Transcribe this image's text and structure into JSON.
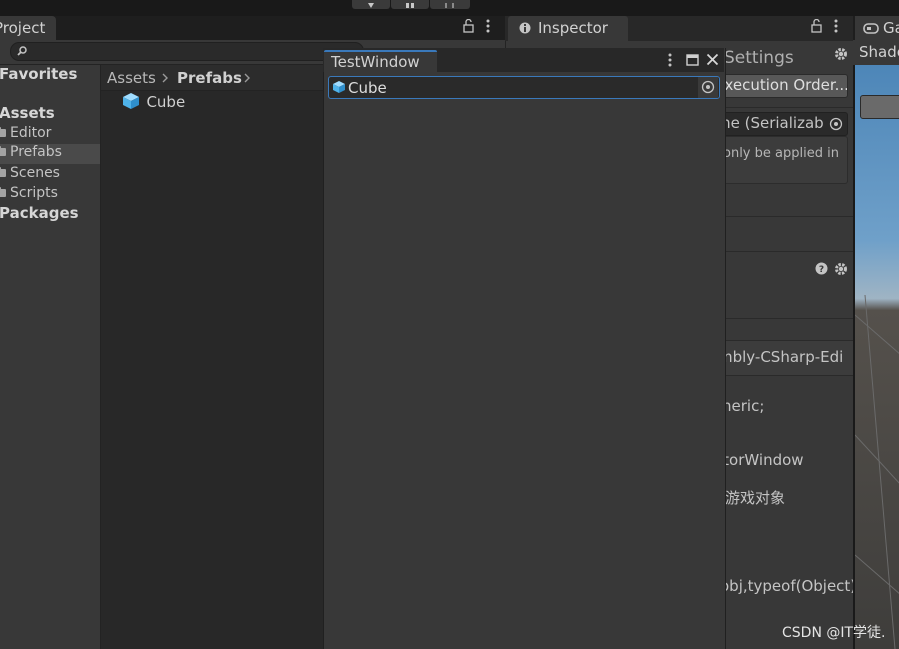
{
  "project_panel": {
    "tab_title": "Project",
    "tree": {
      "favorites": "Favorites",
      "assets": "Assets",
      "folders": [
        "Editor",
        "Prefabs",
        "Scenes",
        "Scripts"
      ],
      "packages": "Packages"
    },
    "breadcrumb": [
      "Assets",
      "Prefabs"
    ],
    "files": [
      {
        "name": "Cube"
      }
    ]
  },
  "inspector": {
    "tab_title": "Inspector",
    "settings_title": "Settings",
    "exec_order_button": "Execution Order...",
    "serialization_field": "me (Serializab",
    "help_text": "only be applied in",
    "assembly_text": "mbly-CSharp-Edi",
    "code_lines": [
      "neric;",
      "itorWindow",
      "游戏对象",
      "obj,typeof(Object)"
    ]
  },
  "game_view": {
    "tab_title": "Game",
    "shading_label": "Shade"
  },
  "test_window": {
    "title": "TestWindow",
    "object_field_value": "Cube"
  },
  "watermark": "CSDN @IT学徒."
}
